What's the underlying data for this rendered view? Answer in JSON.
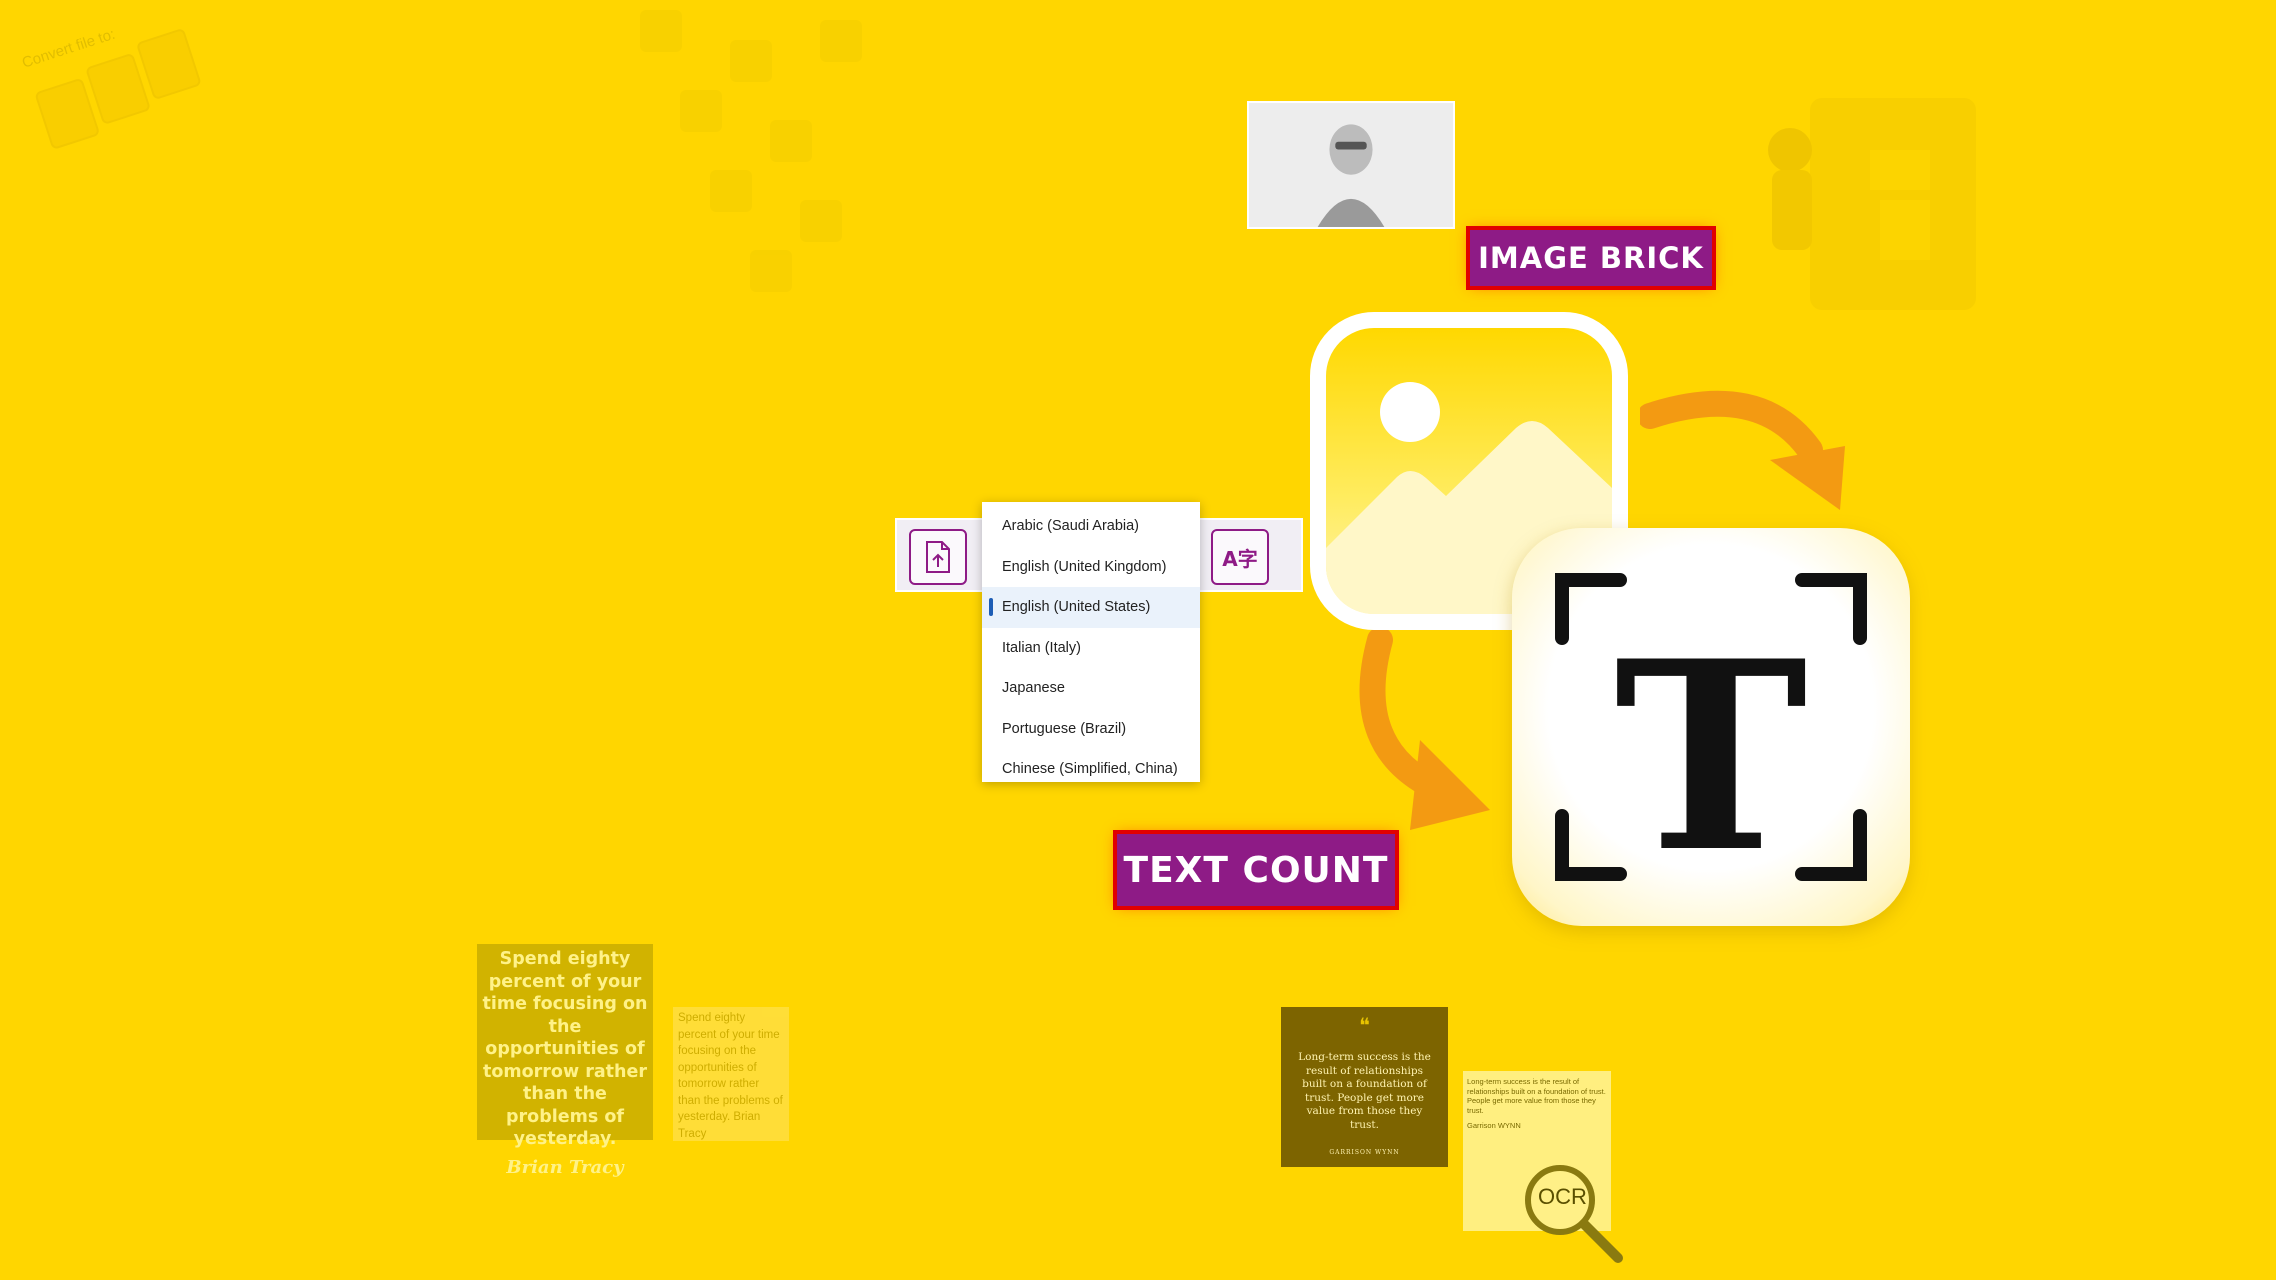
{
  "colors": {
    "background": "#ffd600",
    "accent": "#8e1b86",
    "arrow": "#f39a12"
  },
  "convert_panel": {
    "label": "Convert file to:",
    "close": "×"
  },
  "labels": {
    "image_brick": "IMAGE BRICK",
    "text_count": "TEXT COUNT"
  },
  "toolbar": {
    "file_icon": "file-upload-icon",
    "translate_icon": "translate-icon",
    "translate_glyph": "A字"
  },
  "language_menu": {
    "items": [
      "Arabic (Saudi Arabia)",
      "English (United Kingdom)",
      "English (United States)",
      "Italian (Italy)",
      "Japanese",
      "Portuguese (Brazil)",
      "Chinese (Simplified, China)"
    ],
    "selected": "English (United States)"
  },
  "quote_card": {
    "text": "Spend eighty percent of your time focusing on the opportunities of tomorrow rather than the problems of yesterday.",
    "author": "Brian Tracy"
  },
  "quote_plain": {
    "text": "Spend eighty percent of your time focusing on the opportunities of tomorrow rather than the problems of yesterday. Brian Tracy"
  },
  "dark_quote": {
    "text": "Long-term success is the result of relationships built on a foundation of trust. People get more value from those they trust.",
    "author": "GARRISON WYNN"
  },
  "ocr_card": {
    "text": "Long-term success is the result of relationships built on a foundation of trust. People get more value from those they trust.",
    "author": "Garrison WYNN",
    "lens_label": "OCR"
  },
  "big_icon_letter": "T"
}
